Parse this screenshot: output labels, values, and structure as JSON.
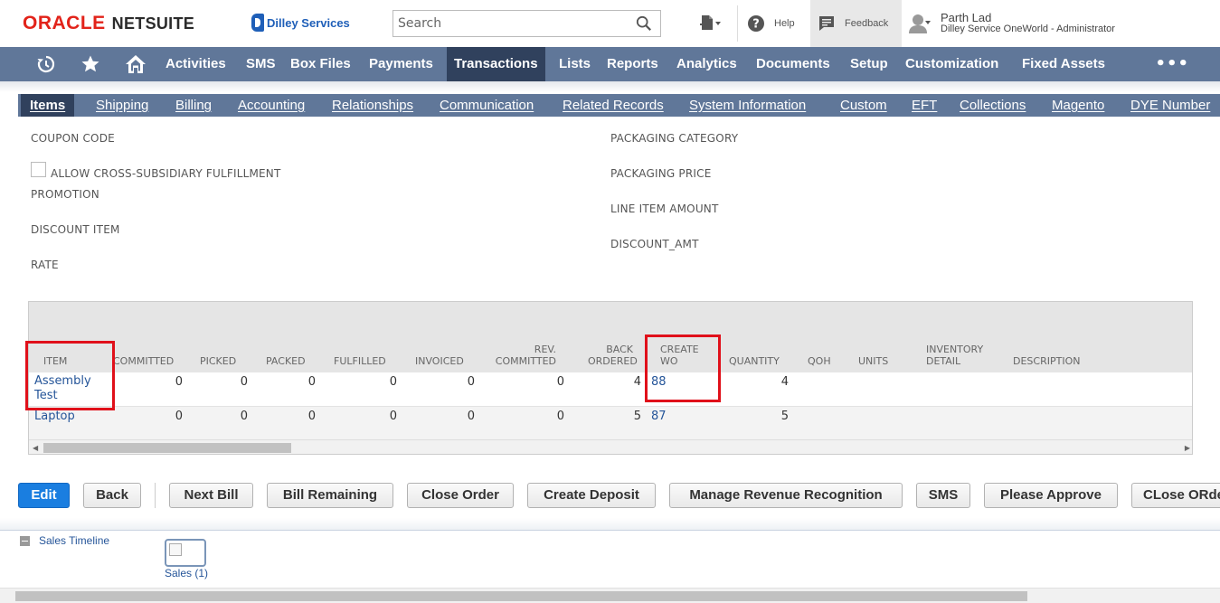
{
  "header": {
    "brand_oracle": "ORACLE",
    "brand_netsuite": "NETSUITE",
    "company_logo_text": "Dilley Services",
    "search": {
      "placeholder": "Search"
    },
    "help_label": "Help",
    "feedback_label": "Feedback",
    "user_name": "Parth Lad",
    "user_role": "Dilley Service OneWorld - Administrator"
  },
  "main_nav": {
    "items": [
      "Activities",
      "SMS",
      "Box Files",
      "Payments",
      "Transactions",
      "Lists",
      "Reports",
      "Analytics",
      "Documents",
      "Setup",
      "Customization",
      "Fixed Assets"
    ],
    "active": "Transactions",
    "more": "•••"
  },
  "subtabs": {
    "items": [
      "Items",
      "Shipping",
      "Billing",
      "Accounting",
      "Relationships",
      "Communication",
      "Related Records",
      "System Information",
      "Custom",
      "EFT",
      "Collections",
      "Magento",
      "DYE Number"
    ],
    "active": "Items"
  },
  "fields": {
    "coupon_code": "COUPON CODE",
    "allow_cross_subsidiary": "ALLOW CROSS-SUBSIDIARY FULFILLMENT",
    "promotion": "PROMOTION",
    "discount_item": "DISCOUNT ITEM",
    "rate": "RATE",
    "packaging_category": "PACKAGING CATEGORY",
    "packaging_price": "PACKAGING PRICE",
    "line_item_amount": "LINE ITEM AMOUNT",
    "discount_amt": "DISCOUNT_AMT"
  },
  "items_table": {
    "headers": {
      "item": "ITEM",
      "committed": "COMMITTED",
      "picked": "PICKED",
      "packed": "PACKED",
      "fulfilled": "FULFILLED",
      "invoiced": "INVOICED",
      "rev_committed_1": "REV.",
      "rev_committed_2": "COMMITTED",
      "back_ordered_1": "BACK",
      "back_ordered_2": "ORDERED",
      "create_wo_1": "CREATE",
      "create_wo_2": "WO",
      "quantity": "QUANTITY",
      "qoh": "QOH",
      "units": "UNITS",
      "inventory_detail_1": "INVENTORY",
      "inventory_detail_2": "DETAIL",
      "description": "DESCRIPTION"
    },
    "rows": [
      {
        "item_line1": "Assembly",
        "item_line2": "Test",
        "committed": "0",
        "picked": "0",
        "packed": "0",
        "fulfilled": "0",
        "invoiced": "0",
        "rev_committed": "0",
        "back_ordered": "4",
        "create_wo": "88",
        "quantity": "4"
      },
      {
        "item_line1": "Laptop",
        "item_line2": "",
        "committed": "0",
        "picked": "0",
        "packed": "0",
        "fulfilled": "0",
        "invoiced": "0",
        "rev_committed": "0",
        "back_ordered": "5",
        "create_wo": "87",
        "quantity": "5"
      }
    ]
  },
  "buttons": {
    "edit": "Edit",
    "back": "Back",
    "next_bill": "Next Bill",
    "bill_remaining": "Bill Remaining",
    "close_order": "Close Order",
    "create_deposit": "Create Deposit",
    "manage_revenue_recognition": "Manage Revenue Recognition",
    "sms": "SMS",
    "please_approve": "Please Approve",
    "close_order_custom": "CLose ORder"
  },
  "timeline": {
    "title": "Sales Timeline",
    "sales_label": "Sales (1)"
  },
  "colors": {
    "nav_bg": "#607799",
    "nav_active": "#30415d",
    "link": "#255599",
    "primary_button": "#1a7ee0",
    "highlight": "#e0101a"
  }
}
